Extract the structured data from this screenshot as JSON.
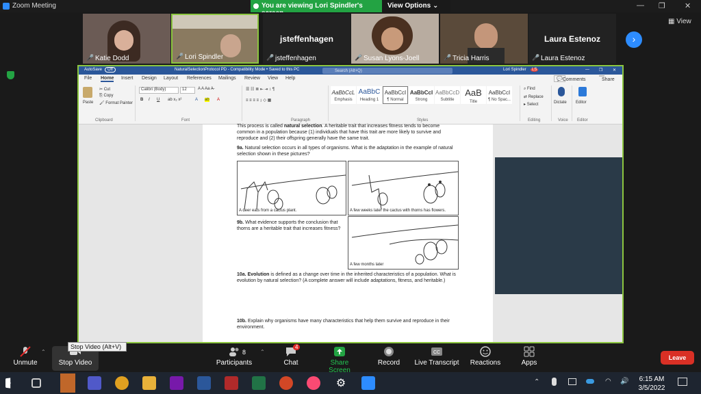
{
  "app": {
    "title": "Zoom Meeting"
  },
  "banner": {
    "text": "You are viewing Lori Spindler's screen",
    "options": "View Options"
  },
  "participants": [
    {
      "name": "Katie Dodd"
    },
    {
      "name": "Lori Spindler"
    },
    {
      "name": "jsteffenhagen",
      "big": "jsteffenhagen"
    },
    {
      "name": "Susan Lyons-Joell"
    },
    {
      "name": "Tricia Harris"
    },
    {
      "name": "Laura Estenoz",
      "big": "Laura Estenoz"
    }
  ],
  "view_label": "View",
  "word": {
    "autosave": "AutoSave",
    "autosave_state": "Off",
    "doc_title": "NaturalSelectionProtocol PD - Compatibility Mode • Saved to this PC",
    "search_placeholder": "Search (Alt+Q)",
    "user": "Lori Spindler",
    "user_initials": "LS",
    "menu": [
      "File",
      "Home",
      "Insert",
      "Design",
      "Layout",
      "References",
      "Mailings",
      "Review",
      "View",
      "Help"
    ],
    "comments": "Comments",
    "share": "Share",
    "clipboard": {
      "paste": "Paste",
      "cut": "Cut",
      "copy": "Copy",
      "painter": "Format Painter",
      "group": "Clipboard"
    },
    "font": {
      "name": "Calibri (Body)",
      "size": "12",
      "group": "Font"
    },
    "paragraph_group": "Paragraph",
    "styles": [
      {
        "sample": "AaBbCcL",
        "label": "Emphasis"
      },
      {
        "sample": "AaBbC",
        "label": "Heading 1"
      },
      {
        "sample": "AaBbCcI",
        "label": "¶ Normal"
      },
      {
        "sample": "AaBbCcI",
        "label": "Strong"
      },
      {
        "sample": "AaBbCcD",
        "label": "Subtitle"
      },
      {
        "sample": "AaB",
        "label": "Title"
      },
      {
        "sample": "AaBbCcI",
        "label": "¶ No Spac..."
      }
    ],
    "styles_group": "Styles",
    "editing": {
      "find": "Find",
      "replace": "Replace",
      "select": "Select",
      "group": "Editing"
    },
    "voice": {
      "dictate": "Dictate",
      "group": "Voice"
    },
    "editor": {
      "label": "Editor",
      "group": "Editor"
    }
  },
  "doc": {
    "p1_a": "This process is called ",
    "p1_b": "natural selection",
    "p1_c": ". A heritable trait that increases fitness tends to become common in a population because (1) individuals that have this trait are more likely to survive and reproduce and (2) their offspring generally have the same trait.",
    "q9a_num": "9a.",
    "q9a": " Natural selection occurs in all types of organisms. What is the adaptation in the example of natural selection shown in these pictures?",
    "cap1": "A deer eats from a cactus plant.",
    "cap2": "A few weeks later the cactus with thorns has flowers.",
    "cap3": "A few months later",
    "q9b_num": "9b.",
    "q9b": " What evidence supports the conclusion that thorns are a heritable trait that increases fitness?",
    "q10a_num": "10a.",
    "q10a_term": " Evolution",
    "q10a": " is defined as a change over time in the inherited characteristics of a population. What is evolution by natural selection? (A complete answer will include adaptations, fitness, and heritable.)",
    "q10b_num": "10b.",
    "q10b": " Explain why organisms have many characteristics that help them survive and reproduce in their environment."
  },
  "controls": {
    "unmute": "Unmute",
    "stop_video": "Stop Video",
    "participants": "Participants",
    "participants_count": "8",
    "chat": "Chat",
    "chat_badge": "4",
    "share_screen": "Share Screen",
    "record": "Record",
    "live_transcript": "Live Transcript",
    "reactions": "Reactions",
    "apps": "Apps",
    "leave": "Leave",
    "tooltip": "Stop Video (Alt+V)"
  },
  "taskbar": {
    "time": "6:15 AM",
    "date": "3/5/2022"
  },
  "colors": {
    "zoom_blue": "#2d8cff",
    "green": "#23a343",
    "word_blue": "#2b579a",
    "leave_red": "#d93025"
  }
}
